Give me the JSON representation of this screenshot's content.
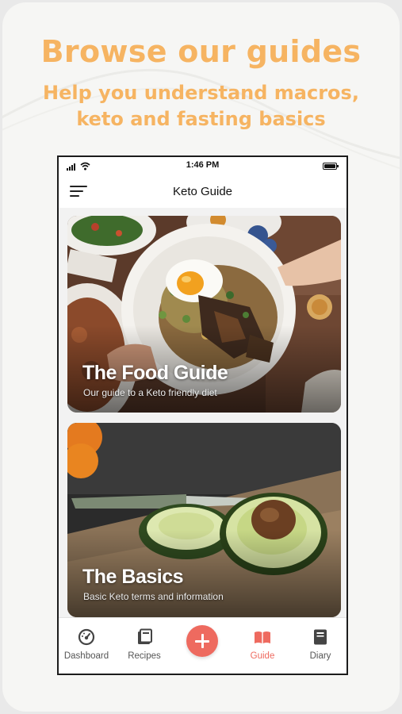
{
  "promo": {
    "headline": "Browse our guides",
    "subhead_line1": "Help you understand macros,",
    "subhead_line2": "keto and fasting basics"
  },
  "status_bar": {
    "time": "1:46 PM"
  },
  "nav": {
    "title": "Keto Guide",
    "menu_icon": "hamburger-menu-icon"
  },
  "guides": [
    {
      "title": "The Food Guide",
      "subtitle": "Our guide to a Keto friendly diet"
    },
    {
      "title": "The Basics",
      "subtitle": "Basic Keto terms and information"
    }
  ],
  "tabs": [
    {
      "label": "Dashboard",
      "icon": "gauge-icon",
      "active": false
    },
    {
      "label": "Recipes",
      "icon": "books-icon",
      "active": false
    },
    {
      "label": "Guide",
      "icon": "open-book-icon",
      "active": true
    },
    {
      "label": "Diary",
      "icon": "notebook-icon",
      "active": false
    }
  ],
  "add_button": {
    "icon": "plus-icon"
  },
  "colors": {
    "accent_orange": "#f6b462",
    "active_tab": "#ee6a5f",
    "add_button": "#ee6a5f"
  }
}
